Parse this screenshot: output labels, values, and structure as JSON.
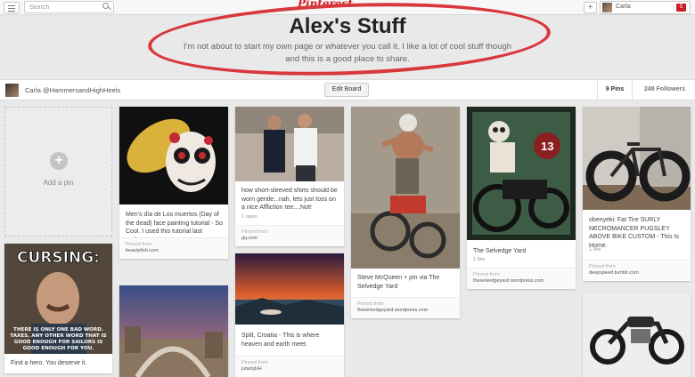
{
  "topbar": {
    "search_placeholder": "Search",
    "logo": "Pinterest",
    "add_label": "+",
    "user_name": "Carla",
    "notification_count": "5"
  },
  "board": {
    "title": "Alex's Stuff",
    "description": "I'm not about to start my own page or whatever you call it. I like a lot of cool stuff though and this is a good place to share.",
    "owner": "Carla @HammersandHighHeels",
    "edit_button": "Edit Board",
    "pins_count": "9 Pins",
    "followers_count": "248 Followers"
  },
  "add_pin": {
    "label": "Add a pin",
    "icon": "+"
  },
  "pins": [
    {
      "description": "Men's día de Los muertos (Day of the dead) face painting tutorial - So Cool. I used this tutorial last Halloween.",
      "source_label": "Pinned from",
      "source": "beautylish.com"
    },
    {
      "description": "how short-sleeved shirts should be worn gentle...nah, lets just toss on a nice Affliction tee....Not!",
      "meta": "1 repin",
      "source_label": "Pinned from",
      "source": "gq.com"
    },
    {
      "description": "Steve McQueen + pin via The Selvedge Yard",
      "source_label": "Pinned from",
      "source": "theselvedgeyard.wordpress.com"
    },
    {
      "description": "The Selvedge Yard",
      "meta": "1 like",
      "source_label": "Pinned from",
      "source": "theselvedgeyard.wordpress.com"
    },
    {
      "description": "obenyeki: Fat Tire SURLY NECROMANCER PUGSLEY ABOVE BIKE CUSTOM - This Is Home.",
      "meta": "1 like",
      "source_label": "Pinned from",
      "source": "deepspeed.tumblr.com"
    },
    {
      "image_text": "CURSING:",
      "image_caption": "THERE IS ONLY ONE BAD WORD. TAXES. ANY OTHER WORD THAT IS GOOD ENOUGH FOR SAILORS IS GOOD ENOUGH FOR YOU.",
      "description": "Find a hero. You deserve it."
    },
    {
      "description": "Split, Croatia - This is where heaven and earth meet.",
      "source_label": "Pinned from",
      "source": "jutamjUH"
    }
  ],
  "colors": {
    "brand_red": "#cb2027",
    "highlight_ring": "#d8373c",
    "background": "#e9e9e9"
  }
}
